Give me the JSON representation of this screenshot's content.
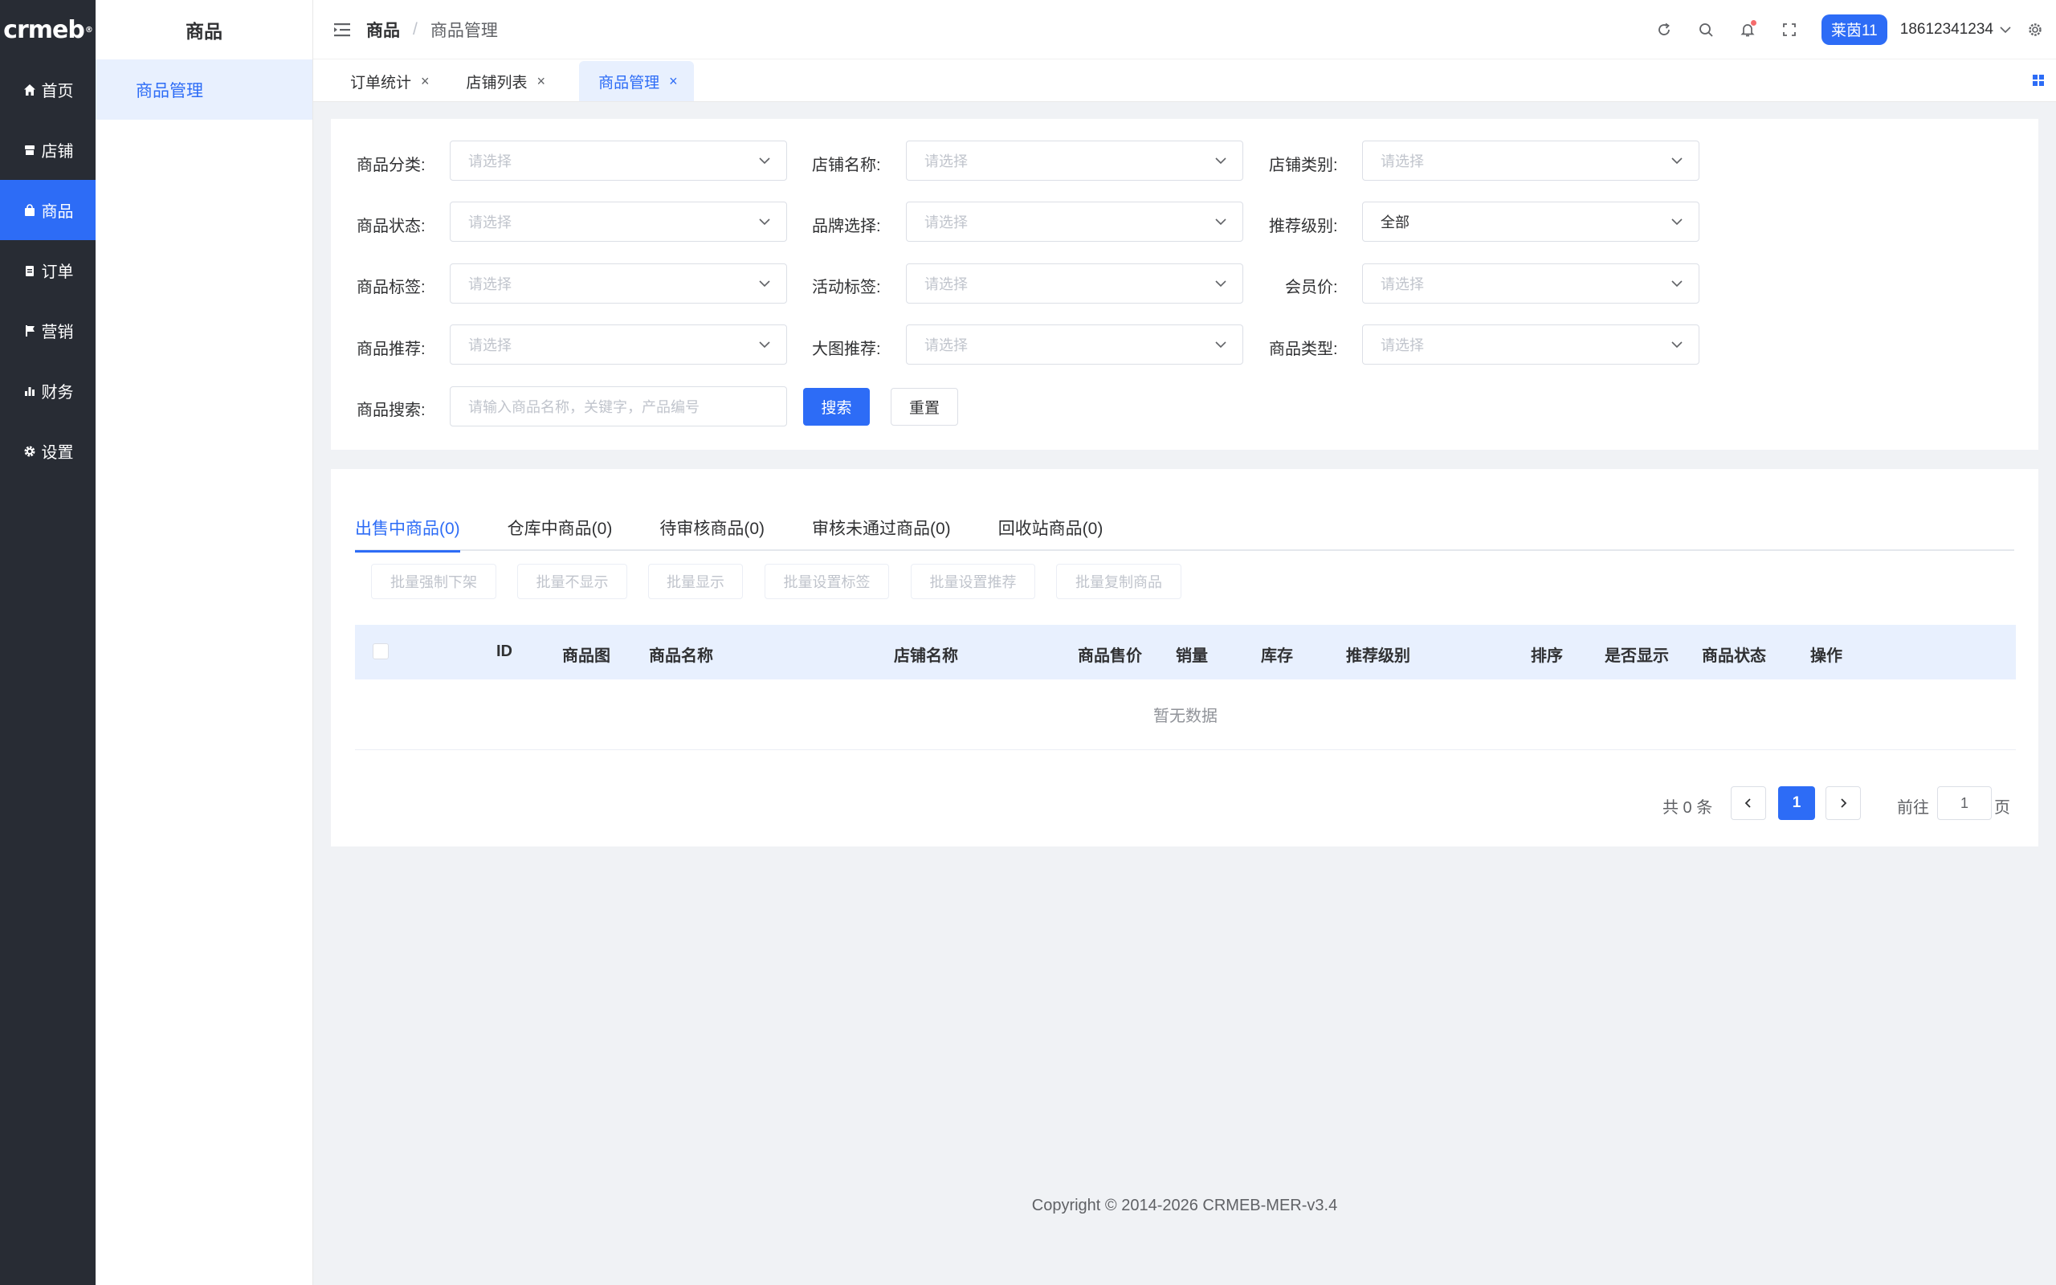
{
  "brand": {
    "logo": "crmeb",
    "logo_mark": "®",
    "accent": "#2d6cf6",
    "sidebar_bg": "#282c34"
  },
  "sidebar": {
    "items": [
      {
        "label": "首页",
        "icon": "home-icon"
      },
      {
        "label": "店铺",
        "icon": "store-icon"
      },
      {
        "label": "商品",
        "icon": "bag-icon",
        "active": true
      },
      {
        "label": "订单",
        "icon": "clipboard-icon"
      },
      {
        "label": "营销",
        "icon": "flag-icon"
      },
      {
        "label": "财务",
        "icon": "bar-chart-icon"
      },
      {
        "label": "设置",
        "icon": "gear-icon"
      }
    ]
  },
  "subsidebar": {
    "title": "商品",
    "items": [
      {
        "label": "商品管理",
        "active": true
      }
    ]
  },
  "header": {
    "breadcrumb": {
      "root": "商品",
      "separator": "/",
      "current": "商品管理"
    },
    "icons": [
      "refresh-icon",
      "search-icon",
      "bell-icon",
      "fullscreen-icon",
      "settings-icon"
    ],
    "shop_name": "莱茵11",
    "user": "18612341234"
  },
  "tags": [
    {
      "label": "订单统计",
      "close": "×"
    },
    {
      "label": "店铺列表",
      "close": "×"
    },
    {
      "label": "商品管理",
      "close": "×",
      "active": true
    }
  ],
  "filters": {
    "category": {
      "label": "商品分类:",
      "placeholder": "请选择"
    },
    "store_name": {
      "label": "店铺名称:",
      "placeholder": "请选择"
    },
    "store_type": {
      "label": "店铺类别:",
      "placeholder": "请选择"
    },
    "status": {
      "label": "商品状态:",
      "placeholder": "请选择"
    },
    "brand": {
      "label": "品牌选择:",
      "placeholder": "请选择"
    },
    "recommend_level": {
      "label": "推荐级别:",
      "value": "全部"
    },
    "product_tag": {
      "label": "商品标签:",
      "placeholder": "请选择"
    },
    "activity_tag": {
      "label": "活动标签:",
      "placeholder": "请选择"
    },
    "member_price": {
      "label": "会员价:",
      "placeholder": "请选择"
    },
    "recommend": {
      "label": "商品推荐:",
      "placeholder": "请选择"
    },
    "big_image": {
      "label": "大图推荐:",
      "placeholder": "请选择"
    },
    "product_type": {
      "label": "商品类型:",
      "placeholder": "请选择"
    },
    "search": {
      "label": "商品搜索:",
      "placeholder": "请输入商品名称，关键字，产品编号"
    },
    "search_button": "搜索",
    "reset_button": "重置"
  },
  "status_tabs": [
    {
      "label": "出售中商品(0)",
      "active": true
    },
    {
      "label": "仓库中商品(0)"
    },
    {
      "label": "待审核商品(0)"
    },
    {
      "label": "审核未通过商品(0)"
    },
    {
      "label": "回收站商品(0)"
    }
  ],
  "batch_actions": [
    "批量强制下架",
    "批量不显示",
    "批量显示",
    "批量设置标签",
    "批量设置推荐",
    "批量复制商品"
  ],
  "table": {
    "columns": [
      "ID",
      "商品图",
      "商品名称",
      "店铺名称",
      "商品售价",
      "销量",
      "库存",
      "推荐级别",
      "排序",
      "是否显示",
      "商品状态",
      "操作"
    ],
    "rows": [],
    "empty_text": "暂无数据"
  },
  "pagination": {
    "total_text": "共 0 条",
    "current_page": "1",
    "goto_label": "前往",
    "goto_value": "1",
    "page_suffix": "页"
  },
  "footer": {
    "copyright": "Copyright © 2014-2026 CRMEB-MER-v3.4"
  }
}
